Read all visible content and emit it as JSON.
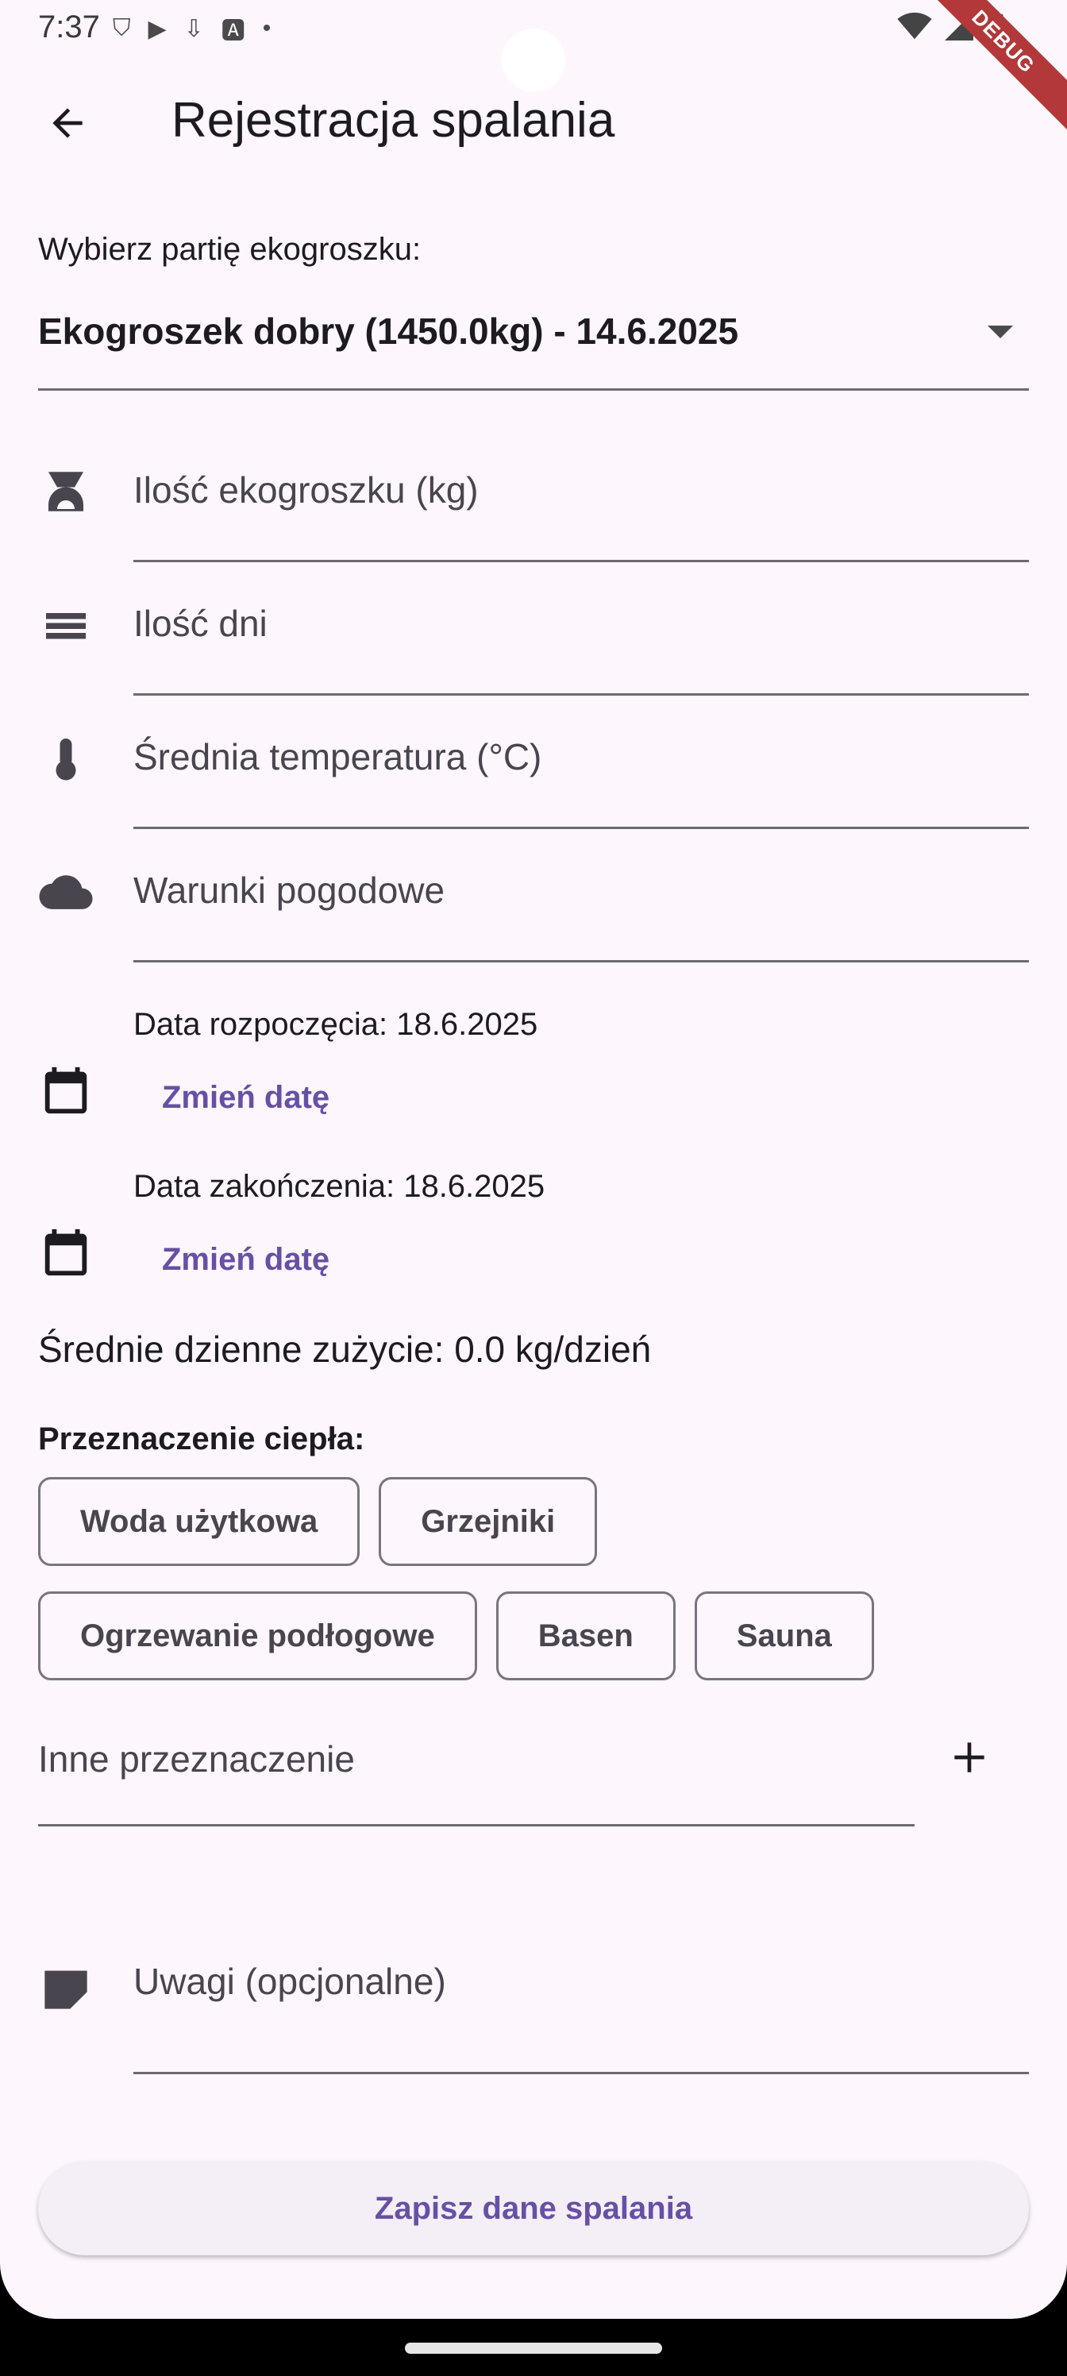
{
  "status_bar": {
    "time": "7:37",
    "debug_label": "DEBUG"
  },
  "app_bar": {
    "title": "Rejestracja spalania"
  },
  "batch": {
    "label": "Wybierz partię ekogroszku:",
    "selected": "Ekogroszek dobry (1450.0kg) - 14.6.2025"
  },
  "fields": {
    "amount_placeholder": "Ilość ekogroszku (kg)",
    "days_placeholder": "Ilość dni",
    "temp_placeholder": "Średnia temperatura (°C)",
    "weather_placeholder": "Warunki pogodowe"
  },
  "dates": {
    "start_label": "Data rozpoczęcia: 18.6.2025",
    "end_label": "Data zakończenia: 18.6.2025",
    "change_label": "Zmień datę"
  },
  "average": "Średnie dzienne zużycie: 0.0 kg/dzień",
  "purpose": {
    "title": "Przeznaczenie ciepła:",
    "row1": [
      "Woda użytkowa",
      "Grzejniki"
    ],
    "row2": [
      "Ogrzewanie podłogowe",
      "Basen",
      "Sauna"
    ],
    "other_placeholder": "Inne przeznaczenie"
  },
  "notes_placeholder": "Uwagi (opcjonalne)",
  "save_label": "Zapisz dane spalania",
  "colors": {
    "background": "#fdf6fd",
    "accent": "#6750a4",
    "text": "#1d1b20"
  }
}
